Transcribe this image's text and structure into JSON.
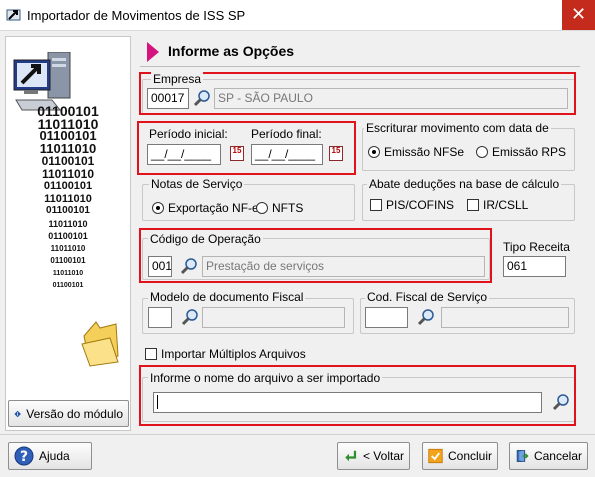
{
  "window": {
    "title": "Importador de Movimentos de ISS SP",
    "close_glyph": "✕"
  },
  "left_panel": {
    "binary_lines": [
      "01100101",
      "11011010",
      "01100101",
      "11011010",
      "01100101",
      "11011010",
      "01100101",
      "11011010",
      "01100101",
      "11011010",
      "01100101",
      "11011010",
      "01100101",
      "11011010",
      "01100101"
    ],
    "version_button": "Versão do módulo"
  },
  "header": {
    "title": "Informe as Opções"
  },
  "empresa": {
    "label": "Empresa",
    "code": "00017",
    "name": "SP - SÃO PAULO"
  },
  "periodo": {
    "inicial_label": "Período inicial:",
    "inicial_value": "__/__/____",
    "final_label": "Período final:",
    "final_value": "__/__/____",
    "calendar_glyph": "15"
  },
  "escriturar": {
    "label": "Escriturar movimento com data de",
    "options": [
      "Emissão NFSe",
      "Emissão RPS"
    ],
    "selected": "Emissão NFSe"
  },
  "notas": {
    "label": "Notas de Serviço",
    "options": [
      "Exportação NF-e",
      "NFTS"
    ],
    "selected": "Exportação NF-e"
  },
  "abate": {
    "label": "Abate deduções na base de cálculo",
    "options": [
      "PIS/COFINS",
      "IR/CSLL"
    ]
  },
  "codigo_operacao": {
    "label": "Código de Operação",
    "code": "001",
    "description": "Prestação de serviços"
  },
  "tipo_receita": {
    "label": "Tipo Receita",
    "value": "061"
  },
  "modelo_doc": {
    "label": "Modelo de documento Fiscal",
    "value": ""
  },
  "cod_fiscal": {
    "label": "Cod. Fiscal de Serviço",
    "value": ""
  },
  "importar_multiplos": {
    "label": "Importar Múltiplos Arquivos",
    "checked": false
  },
  "arquivo": {
    "label": "Informe o nome do arquivo a ser importado",
    "value": ""
  },
  "buttons": {
    "ajuda": "Ajuda",
    "voltar": "< Voltar",
    "concluir": "Concluir",
    "cancelar": "Cancelar"
  },
  "colors": {
    "highlight": "#e0131d",
    "accent": "#d4147c"
  }
}
